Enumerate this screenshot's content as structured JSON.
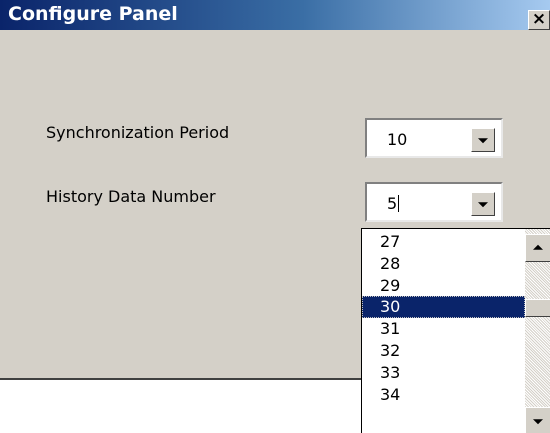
{
  "window": {
    "title": "Configure Panel",
    "close_label": "×"
  },
  "fields": {
    "sync_period_label": "Synchronization Period",
    "sync_period_value": "10",
    "history_label": "History Data Number",
    "history_value": "5"
  },
  "dropdown": {
    "options": [
      "27",
      "28",
      "29",
      "30",
      "31",
      "32",
      "33",
      "34"
    ],
    "selected": "30"
  },
  "colors": {
    "titlebar_start": "#0a246a",
    "titlebar_end": "#a6caf0",
    "selection": "#0a246a",
    "window_face": "#d4d0c8"
  }
}
